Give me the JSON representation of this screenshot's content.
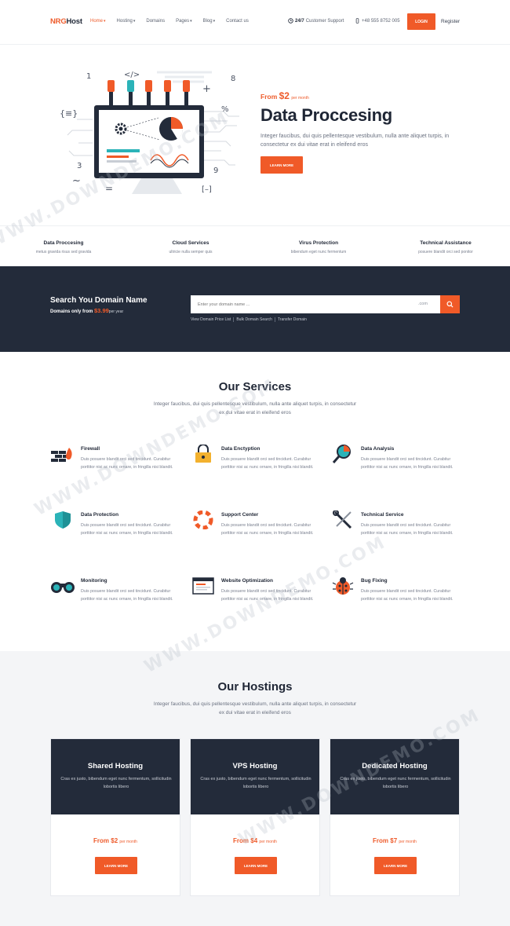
{
  "header": {
    "logo_a": "NRG",
    "logo_b": "Host",
    "nav": [
      {
        "label": "Home",
        "dropdown": true,
        "active": true
      },
      {
        "label": "Hosting",
        "dropdown": true
      },
      {
        "label": "Domains",
        "dropdown": false
      },
      {
        "label": "Pages",
        "dropdown": true
      },
      {
        "label": "Blog",
        "dropdown": true
      },
      {
        "label": "Contact us",
        "dropdown": false
      }
    ],
    "support_bold": "24/7",
    "support_text": "Customer Support",
    "phone": "+48 555 8752 005",
    "login": "LOGIN",
    "register": "Register"
  },
  "hero": {
    "price_prefix": "From",
    "price": "$2",
    "price_per": "per month",
    "title": "Data Proccesing",
    "text": "Integer faucibus, dui quis pellentesque vestibulum, nulla ante aliquet turpis, in consectetur ex dui vitae erat in eleifend eros",
    "button": "LEARN MORE",
    "art_glyphs": [
      "1",
      "</>",
      "8",
      "+",
      "%",
      "{≡}",
      "3",
      "~",
      "=",
      "9",
      "[–]"
    ]
  },
  "features": [
    {
      "title": "Data Proccesing",
      "sub": "metus gravida risus sed gravida"
    },
    {
      "title": "Cloud Services",
      "sub": "ultricie nulla semper quis"
    },
    {
      "title": "Virus Protection",
      "sub": "bibendum eget nunc fermentum"
    },
    {
      "title": "Technical Assistance",
      "sub": "posuere blandit orci sed ponitor"
    }
  ],
  "domain": {
    "title": "Search You Domain Name",
    "sub_prefix": "Domains only from",
    "price": "$3.99",
    "per": "per year",
    "placeholder": "Enter your domain name ...",
    "tld": ".com",
    "links": [
      "View Domain Price List",
      "Bulk Domain Search",
      "Transfer Domain"
    ]
  },
  "services": {
    "title": "Our Services",
    "sub": "Integer faucibus, dui quis pellentesque vestibulum, nulla ante aliquet turpis, in consectetur ex dui vitae erat in eleifend eros",
    "desc": "Duis posuere blandit orci sed tincidunt. Curabitur porttitor nisi ac nunc ornare, in fringilla nisi blandit.",
    "items": [
      {
        "title": "Firewall",
        "icon": "firewall-icon"
      },
      {
        "title": "Data Enctyption",
        "icon": "lock-icon"
      },
      {
        "title": "Data Analysis",
        "icon": "magnifier-chart-icon"
      },
      {
        "title": "Data Protection",
        "icon": "shield-icon"
      },
      {
        "title": "Support Center",
        "icon": "lifebuoy-icon"
      },
      {
        "title": "Technical Service",
        "icon": "tools-icon"
      },
      {
        "title": "Monitoring",
        "icon": "binoculars-icon"
      },
      {
        "title": "Website Optimization",
        "icon": "browser-icon"
      },
      {
        "title": "Bug Fixing",
        "icon": "bug-icon"
      }
    ]
  },
  "hostings": {
    "title": "Our Hostings",
    "sub": "Integer faucibus, dui quis pellentesque vestibulum, nulla ante aliquet turpis, in consectetur ex dui vitae erat in eleifend eros",
    "cards": [
      {
        "name": "Shared Hosting",
        "desc": "Cras ex justo, bibendum eget nunc fermentum, sollicitudin lobortis libero",
        "prefix": "From",
        "price": "$2",
        "per": "per month",
        "button": "LEARN MORE"
      },
      {
        "name": "VPS Hosting",
        "desc": "Cras ex justo, bibendum eget nunc fermentum, sollicitudin lobortis libero",
        "prefix": "From",
        "price": "$4",
        "per": "per month",
        "button": "LEARN MORE"
      },
      {
        "name": "Dedicated Hosting",
        "desc": "Cras ex justo, bibendum eget nunc fermentum, sollicitudin lobortis libero",
        "prefix": "From",
        "price": "$7",
        "per": "per month",
        "button": "LEARN MORE"
      }
    ]
  },
  "watermark": "WWW.DOWNDEMO.COM",
  "colors": {
    "accent": "#f05a28",
    "dark": "#232b3a",
    "light_bg": "#f4f5f7",
    "teal": "#2bb3b8"
  }
}
